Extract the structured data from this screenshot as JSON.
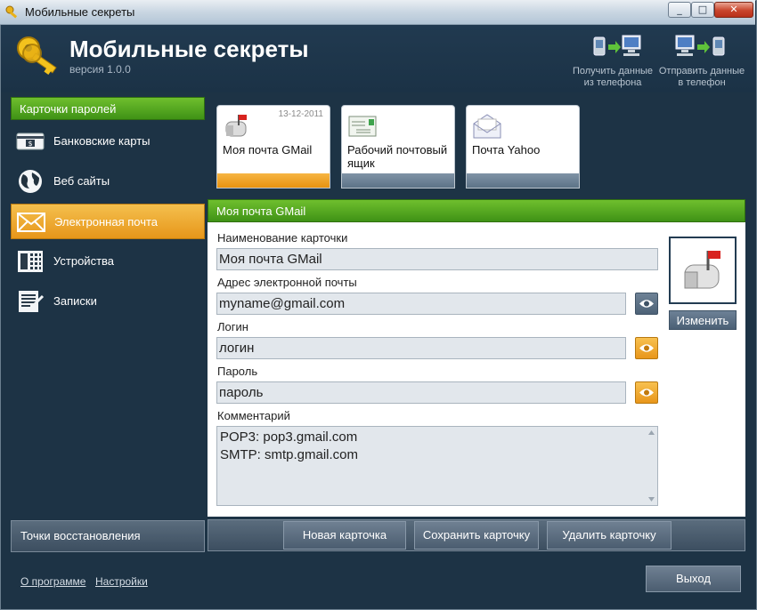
{
  "window": {
    "title": "Мобильные секреты",
    "buttons": {
      "minimize": "_",
      "maximize": "□",
      "close": "✕"
    }
  },
  "header": {
    "app_title": "Мобильные секреты",
    "version": "версия 1.0.0",
    "actions": [
      {
        "label": "Получить данные\nиз телефона",
        "line1": "Получить данные",
        "line2": "из телефона",
        "icon": "phone-to-pc-icon"
      },
      {
        "label": "Отправить данные\nв телефон",
        "line1": "Отправить данные",
        "line2": "в телефон",
        "icon": "pc-to-phone-icon"
      }
    ]
  },
  "sidebar": {
    "title": "Карточки паролей",
    "items": [
      {
        "label": "Банковские карты",
        "icon": "bank-card-icon",
        "active": false
      },
      {
        "label": "Веб сайты",
        "icon": "globe-icon",
        "active": false
      },
      {
        "label": "Электронная почта",
        "icon": "envelope-icon",
        "active": true
      },
      {
        "label": "Устройства",
        "icon": "device-icon",
        "active": false
      },
      {
        "label": "Записки",
        "icon": "notes-icon",
        "active": false
      }
    ],
    "restore_points": "Точки восстановления"
  },
  "cards": [
    {
      "label": "Моя почта GMail",
      "date": "13-12-2011",
      "icon": "mailbox-icon",
      "selected": true
    },
    {
      "label": "Рабочий почтовый ящик",
      "date": "",
      "icon": "letter-icon",
      "selected": false
    },
    {
      "label": "Почта Yahoo",
      "date": "",
      "icon": "envelope-open-icon",
      "selected": false
    }
  ],
  "detail": {
    "title": "Моя почта GMail",
    "fields": {
      "name_label": "Наименование карточки",
      "name_value": "Моя почта GMail",
      "email_label": "Адрес электронной почты",
      "email_value": "myname@gmail.com",
      "login_label": "Логин",
      "login_value": "логин",
      "password_label": "Пароль",
      "password_value": "пароль",
      "comment_label": "Комментарий",
      "comment_value": "POP3: pop3.gmail.com\nSMTP: smtp.gmail.com"
    },
    "change_button": "Изменить"
  },
  "toolbar": {
    "new_card": "Новая карточка",
    "save_card": "Сохранить карточку",
    "delete_card": "Удалить карточку"
  },
  "footer": {
    "about": "О программе",
    "settings": "Настройки",
    "exit": "Выход"
  },
  "colors": {
    "background": "#1d3345",
    "green_header": "#3f9216",
    "orange_active": "#e8961b",
    "field_bg": "#e2e7ec"
  }
}
